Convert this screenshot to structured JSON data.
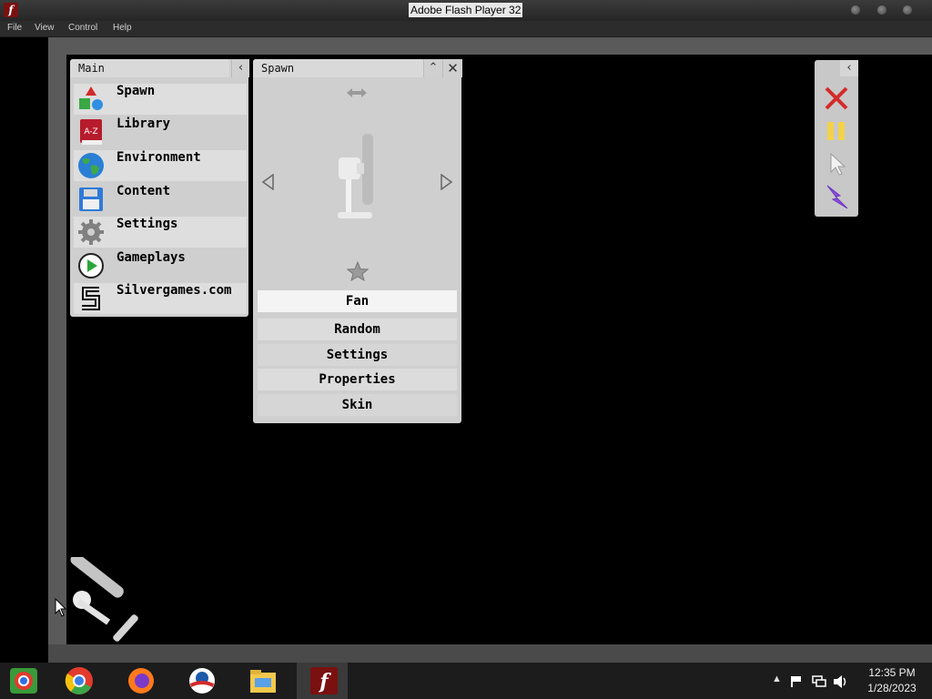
{
  "window": {
    "title": "Adobe Flash Player 32"
  },
  "menu": [
    "File",
    "View",
    "Control",
    "Help"
  ],
  "main_panel": {
    "title": "Main",
    "items": [
      {
        "label": "Spawn",
        "icon": "spawn-shapes-icon"
      },
      {
        "label": "Library",
        "icon": "book-icon"
      },
      {
        "label": "Environment",
        "icon": "globe-icon"
      },
      {
        "label": "Content",
        "icon": "floppy-disk-icon"
      },
      {
        "label": "Settings",
        "icon": "gear-icon"
      },
      {
        "label": "Gameplays",
        "icon": "play-icon"
      },
      {
        "label": "Silvergames.com",
        "icon": "silvergames-logo-icon"
      }
    ]
  },
  "spawn_panel": {
    "title": "Spawn",
    "book_letters": "A-Z",
    "selected_item": "Fan",
    "options": [
      "Random",
      "Settings",
      "Properties",
      "Skin"
    ]
  },
  "toolbar": {
    "tools": [
      "close-icon",
      "pause-icon",
      "cursor-icon",
      "lightning-icon"
    ]
  },
  "taskbar": {
    "apps": [
      "chrome-app-icon",
      "chrome-icon",
      "firefox-icon",
      "campaign-logo-icon",
      "file-explorer-icon",
      "flash-player-icon"
    ],
    "time": "12:35 PM",
    "date": "1/28/2023"
  },
  "colors": {
    "flash_red": "#7a1010",
    "accent_yellow": "#f2d24a",
    "lightning_purple": "#8a4ee0",
    "close_red": "#d42a2a"
  }
}
